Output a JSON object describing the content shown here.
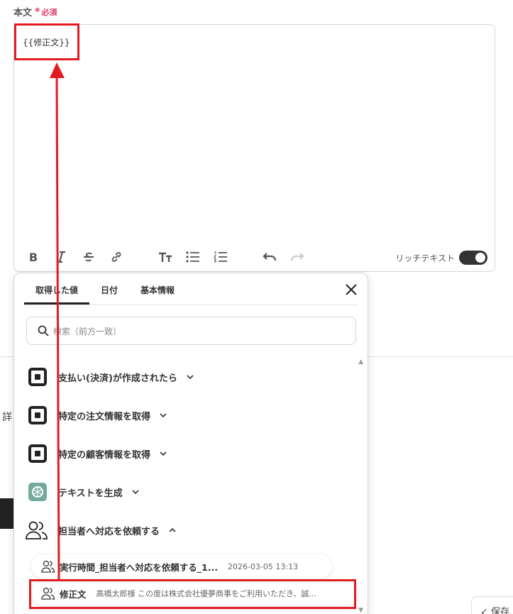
{
  "field": {
    "label": "本文",
    "required_mark": "*",
    "required_text": "必須"
  },
  "editor": {
    "content": "{{修正文}}",
    "toolbar": [
      "bold-icon",
      "italic-icon",
      "strikethrough-icon",
      "link-icon",
      "text-size-icon",
      "bullet-list-icon",
      "numbered-list-icon",
      "undo-icon",
      "redo-icon"
    ],
    "rich_text_label": "リッチテキスト",
    "rich_text_enabled": true
  },
  "popup": {
    "tabs": [
      {
        "label": "取得した値",
        "active": true
      },
      {
        "label": "日付",
        "active": false
      },
      {
        "label": "基本情報",
        "active": false
      }
    ],
    "search_placeholder": "検索（前方一致）",
    "items": [
      {
        "icon": "square-app-icon",
        "label": "支払い(決済)が作成されたら",
        "expanded": false
      },
      {
        "icon": "square-app-icon",
        "label": "特定の注文情報を取得",
        "expanded": false
      },
      {
        "icon": "square-app-icon",
        "label": "特定の顧客情報を取得",
        "expanded": false
      },
      {
        "icon": "openai-icon",
        "label": "テキストを生成",
        "expanded": false
      },
      {
        "icon": "people-icon",
        "label": "担当者へ対応を依頼する",
        "expanded": true
      }
    ],
    "values": [
      {
        "name": "実行時間_担当者へ対応を依頼する_1...",
        "meta": "2026-03-05 13:13"
      },
      {
        "name": "修正文",
        "meta": "高橋太郎様 この度は株式会社優夢商事をご利用いただき、誠..."
      }
    ]
  },
  "side_text": "詳",
  "save_label": "保存",
  "colors": {
    "accent_red": "#e21b22",
    "required": "#e03c6b",
    "toggle": "#333333"
  }
}
